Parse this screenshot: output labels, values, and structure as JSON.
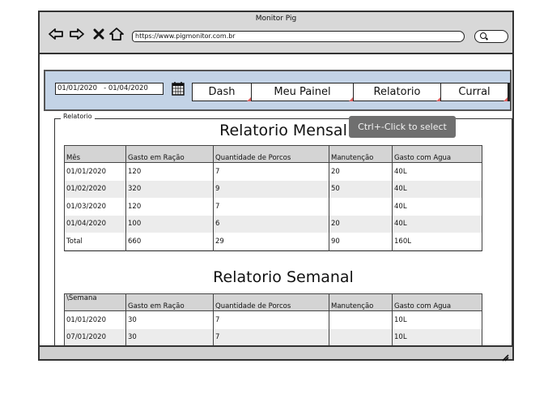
{
  "window": {
    "title": "Monitor Pig"
  },
  "browser": {
    "url": "https://www.pigmonitor.com.br"
  },
  "toolbar": {
    "date_range": "01/01/2020   - 01/04/2020",
    "tabs": [
      {
        "label": "Dash"
      },
      {
        "label": "Meu Painel"
      },
      {
        "label": "Relatorio"
      },
      {
        "label": "Curral"
      }
    ]
  },
  "panel": {
    "legend": "Relatorio"
  },
  "tooltip": {
    "text": "Ctrl+-Click to select"
  },
  "monthly": {
    "title": "Relatorio Mensal",
    "headers": [
      "Mês",
      "Gasto em Ração",
      "Quantidade de Porcos",
      "Manutenção",
      "Gasto com Agua"
    ],
    "rows": [
      [
        "01/01/2020",
        "120",
        "7",
        "20",
        "40L"
      ],
      [
        "01/02/2020",
        "320",
        "9",
        "50",
        "40L"
      ],
      [
        "01/03/2020",
        "120",
        "7",
        "",
        "40L"
      ],
      [
        "01/04/2020",
        "100",
        "6",
        " 20",
        "40L"
      ],
      [
        "Total",
        "660",
        "29",
        "90",
        "160L"
      ]
    ]
  },
  "weekly": {
    "title": "Relatorio Semanal",
    "headers": [
      "\\Semana",
      "Gasto em Ração",
      "Quantidade de Porcos",
      "Manutenção",
      "Gasto com Agua"
    ],
    "rows": [
      [
        "01/01/2020",
        "30",
        "7",
        "",
        "10L"
      ],
      [
        "07/01/2020",
        "30",
        "7",
        "",
        "10L"
      ]
    ]
  }
}
